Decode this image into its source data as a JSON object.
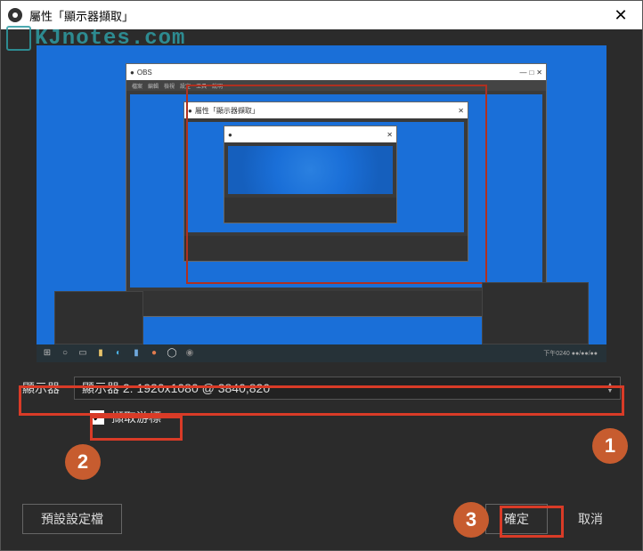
{
  "window": {
    "title": "屬性「顯示器擷取」",
    "close_glyph": "✕"
  },
  "watermark": {
    "text": "KJnotes.com"
  },
  "preview": {
    "inner_title": "屬性「顯示器擷取」",
    "taskbar_time": "下午0240\n●●/●●/●●"
  },
  "display_row": {
    "label": "顯示器",
    "value": "顯示器 2: 1920x1080 @ 3840,820"
  },
  "capture_cursor": {
    "checked_glyph": "✔",
    "label": "擷取游標"
  },
  "buttons": {
    "preset": "預設設定檔",
    "ok": "確定",
    "cancel": "取消"
  },
  "callouts": {
    "one": "1",
    "two": "2",
    "three": "3"
  }
}
